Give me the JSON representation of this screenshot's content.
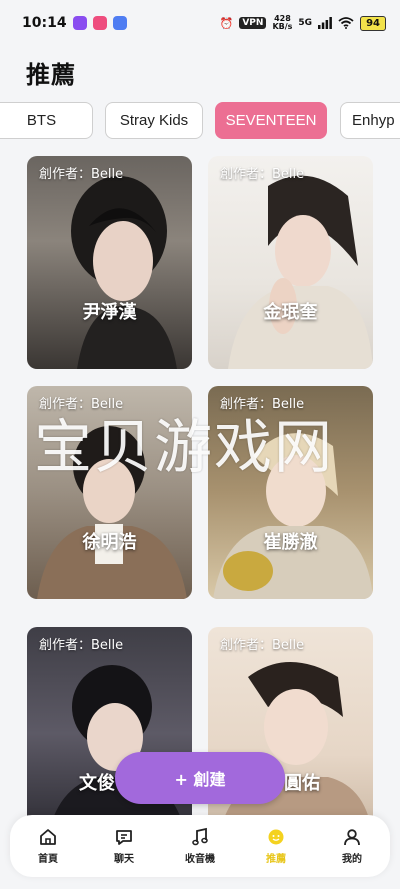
{
  "status_bar": {
    "time": "10:14",
    "vpn": "VPN",
    "speed_value": "428",
    "speed_unit": "KB/s",
    "network": "5G",
    "battery": "94"
  },
  "page": {
    "title": "推薦"
  },
  "tabs": [
    {
      "label": "BTS",
      "active": false
    },
    {
      "label": "Stray Kids",
      "active": false
    },
    {
      "label": "SEVENTEEN",
      "active": true
    },
    {
      "label": "Enhyp",
      "active": false
    }
  ],
  "cards": [
    {
      "author": "創作者：Belle",
      "name": "尹淨漢"
    },
    {
      "author": "創作者：Belle",
      "name": "金珉奎"
    },
    {
      "author": "創作者：Belle",
      "name": "徐明浩"
    },
    {
      "author": "創作者：Belle",
      "name": "崔勝澈"
    },
    {
      "author": "創作者：Belle",
      "name": "文俊"
    },
    {
      "author": "創作者：Belle",
      "name": "圓佑"
    }
  ],
  "watermark": "宝贝游戏网",
  "create_button": {
    "label": "+ 創建"
  },
  "bottom_nav": [
    {
      "label": "首頁",
      "icon": "home-icon"
    },
    {
      "label": "聊天",
      "icon": "chat-icon"
    },
    {
      "label": "收音機",
      "icon": "music-icon"
    },
    {
      "label": "推薦",
      "icon": "recommend-icon",
      "active": true
    },
    {
      "label": "我的",
      "icon": "profile-icon"
    }
  ],
  "colors": {
    "active_tab": "#ec6f93",
    "create_button": "#a269dc",
    "nav_active": "#e8c61a"
  }
}
